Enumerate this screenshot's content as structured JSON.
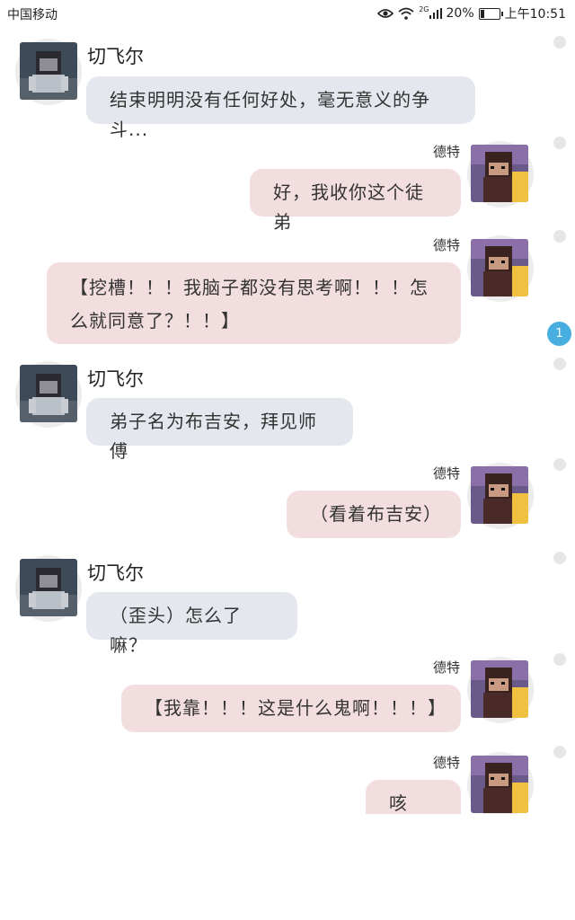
{
  "status_bar": {
    "carrier": "中国移动",
    "network": "2G",
    "battery": "20%",
    "battery_level": 0.2,
    "time": "上午10:51"
  },
  "messages": [
    {
      "side": "left",
      "name": "切飞尔",
      "text": "结束明明没有任何好处，毫无意义的争斗..."
    },
    {
      "side": "right",
      "name": "德特",
      "text": "好，我收你这个徒弟"
    },
    {
      "side": "right",
      "name": "德特",
      "text": "【挖槽！！！我脑子都没有思考啊！！！怎么就同意了？！！】"
    },
    {
      "side": "left",
      "name": "切飞尔",
      "text": "弟子名为布吉安，拜见师傅"
    },
    {
      "side": "right",
      "name": "德特",
      "text": "（看着布吉安）"
    },
    {
      "side": "left",
      "name": "切飞尔",
      "text": "（歪头）怎么了嘛？"
    },
    {
      "side": "right",
      "name": "德特",
      "text": "【我靠！！！这是什么鬼啊！！！】"
    },
    {
      "side": "right",
      "name": "德特",
      "text": "咳咳..."
    }
  ],
  "unread_badge": "1",
  "colors": {
    "left_bubble": "#e4e8ee",
    "right_bubble": "#f3dedf",
    "badge": "#48aee0"
  },
  "icons": {
    "eye": "eye-icon",
    "wifi": "wifi-icon",
    "signal": "signal-icon",
    "battery": "battery-icon"
  }
}
